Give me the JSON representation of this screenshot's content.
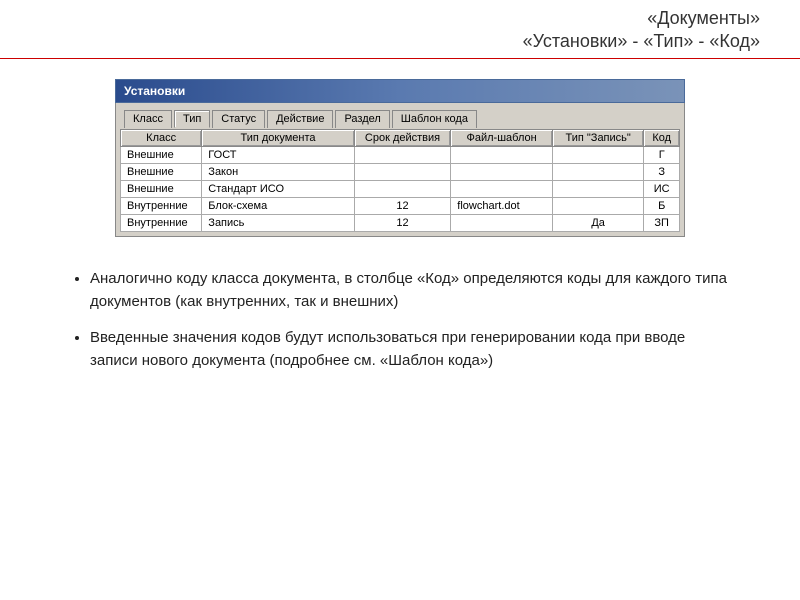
{
  "header": {
    "line1": "«Документы»",
    "line2": "«Установки» - «Тип» - «Код»"
  },
  "window": {
    "title": "Установки",
    "tabs": [
      "Класс",
      "Тип",
      "Статус",
      "Действие",
      "Раздел",
      "Шаблон кода"
    ],
    "active_tab_index": 1,
    "columns": [
      "Класс",
      "Тип документа",
      "Срок действия",
      "Файл-шаблон",
      "Тип \"Запись\"",
      "Код"
    ],
    "rows": [
      {
        "class": "Внешние",
        "type": "ГОСТ",
        "term": "",
        "file": "",
        "rec": "",
        "code": "Г"
      },
      {
        "class": "Внешние",
        "type": "Закон",
        "term": "",
        "file": "",
        "rec": "",
        "code": "З"
      },
      {
        "class": "Внешние",
        "type": "Стандарт ИСО",
        "term": "",
        "file": "",
        "rec": "",
        "code": "ИС"
      },
      {
        "class": "Внутренние",
        "type": "Блок-схема",
        "term": "12",
        "file": "flowchart.dot",
        "rec": "",
        "code": "Б"
      },
      {
        "class": "Внутренние",
        "type": "Запись",
        "term": "12",
        "file": "",
        "rec": "Да",
        "code": "ЗП"
      }
    ]
  },
  "bullets": [
    "Аналогично коду класса документа, в столбце «Код» определяются коды для каждого типа документов (как внутренних, так и внешних)",
    "Введенные значения кодов будут использоваться при генерировании кода при вводе записи нового документа (подробнее см. «Шаблон кода»)"
  ]
}
